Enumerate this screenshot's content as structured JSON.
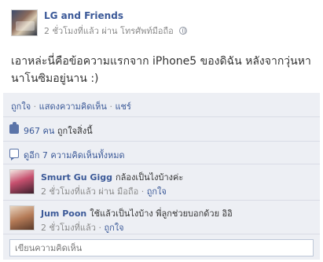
{
  "post": {
    "author": "LG and Friends",
    "meta": "2 ชั่วโมงที่แล้ว ผ่าน โทรศัพท์มือถือ",
    "text": "เอาหล่ะนี่คือข้อความแรกจาก iPhone5 ของดิฉัน หลังจากวุ่นหานาโนซิมอยู่นาน :)"
  },
  "actions": {
    "like": "ถูกใจ",
    "comment": "แสดงความคิดเห็น",
    "share": "แชร์",
    "separator": "·"
  },
  "likes": {
    "count": "967 คน",
    "suffix": "ถูกใจสิ่งนี้"
  },
  "comments_summary": "ดูอีก 7 ความคิดเห็นทั้งหมด",
  "comments": [
    {
      "name": "Smurt Gu Gigg",
      "text": "กล้องเป็นไงบ้างค่ะ",
      "meta": "2 ชั่วโมงที่แล้ว ผ่าน มือถือ",
      "like": "ถูกใจ"
    },
    {
      "name": "Jum Poon",
      "text": "ใช้แล้วเป็นไงบ้าง พี่ลูกช่วยบอกด้วย อิอิ",
      "meta": "2 ชั่วโมงที่แล้ว",
      "like": "ถูกใจ"
    }
  ],
  "write_comment": {
    "placeholder": "เขียนความคิดเห็น"
  },
  "colors": {
    "link": "#3b5998",
    "muted": "#8b8b8b",
    "panel": "#edeff4"
  },
  "icons": [
    "globe-icon",
    "like-thumb-icon",
    "comment-bubble-icon"
  ]
}
